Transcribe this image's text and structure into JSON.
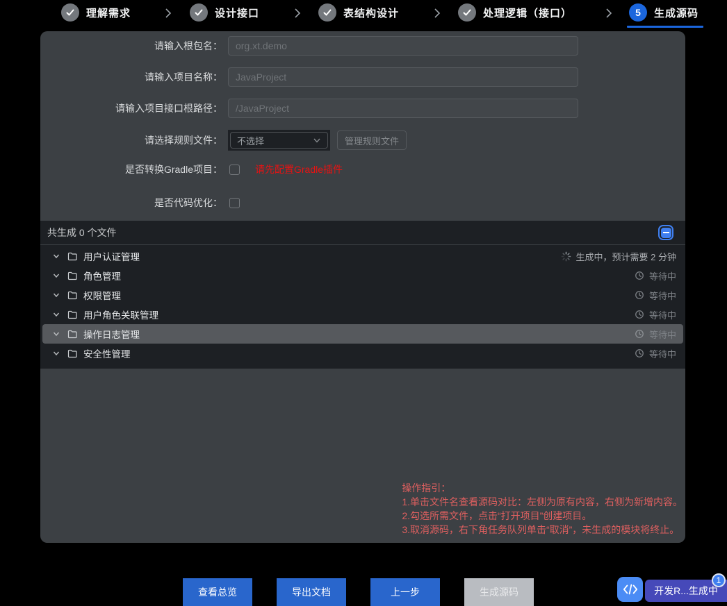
{
  "stepper": {
    "steps": [
      {
        "label": "理解需求",
        "state": "done"
      },
      {
        "label": "设计接口",
        "state": "done"
      },
      {
        "label": "表结构设计",
        "state": "done"
      },
      {
        "label": "处理逻辑（接口）",
        "state": "done"
      },
      {
        "label": "生成源码",
        "state": "active",
        "number": "5"
      }
    ]
  },
  "form": {
    "package": {
      "label": "请输入根包名：",
      "placeholder": "org.xt.demo",
      "value": ""
    },
    "project": {
      "label": "请输入项目名称：",
      "placeholder": "JavaProject",
      "value": ""
    },
    "api_root": {
      "label": "请输入项目接口根路径：",
      "placeholder": "/JavaProject",
      "value": ""
    },
    "rule": {
      "label": "请选择规则文件：",
      "selected": "不选择",
      "manage_button": "管理规则文件"
    },
    "gradle": {
      "label": "是否转换Gradle项目：",
      "checked": false,
      "warning": "请先配置Gradle插件"
    },
    "optimize": {
      "label": "是否代码优化：",
      "checked": false
    }
  },
  "file_section": {
    "summary": "共生成 0 个文件",
    "rows": [
      {
        "name": "用户认证管理",
        "status": "生成中，预计需要 2 分钟",
        "status_type": "generating",
        "highlighted": false
      },
      {
        "name": "角色管理",
        "status": "等待中",
        "status_type": "waiting",
        "highlighted": false
      },
      {
        "name": "权限管理",
        "status": "等待中",
        "status_type": "waiting",
        "highlighted": false
      },
      {
        "name": "用户角色关联管理",
        "status": "等待中",
        "status_type": "waiting",
        "highlighted": false
      },
      {
        "name": "操作日志管理",
        "status": "等待中",
        "status_type": "waiting",
        "highlighted": true
      },
      {
        "name": "安全性管理",
        "status": "等待中",
        "status_type": "waiting",
        "highlighted": false
      }
    ]
  },
  "instructions": {
    "title": "操作指引：",
    "line1": "1.单击文件名查看源码对比：左侧为原有内容，右侧为新增内容。",
    "line2": "2.勾选所需文件，点击“打开项目”创建项目。",
    "line3": "3.取消源码，右下角任务队列单击“取消”，未生成的模块将终止。"
  },
  "footer": {
    "overview_button": "查看总览",
    "export_button": "导出文档",
    "prev_button": "上一步",
    "generate_button": "生成源码"
  },
  "taskbar": {
    "label": "开发R...生成中",
    "badge": "1"
  },
  "colors": {
    "accent_blue": "#1b66dd",
    "button_blue": "#2966cc",
    "panel_gray": "#3c4044",
    "list_dark": "#1d2024",
    "warning_red": "#e81212",
    "instruction_red": "#de5f5f",
    "task_indigo": "#4649b9"
  }
}
